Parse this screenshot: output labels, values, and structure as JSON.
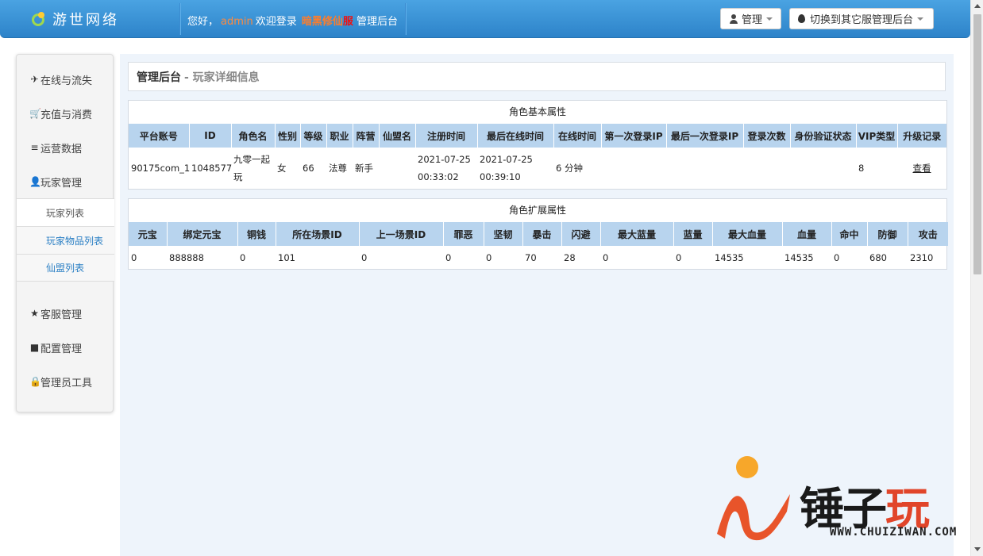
{
  "header": {
    "brand": "游世网络",
    "welcome_prefix": "您好，",
    "username": "admin",
    "welcome_mid": "欢迎登录",
    "server_name": "暗黑修仙",
    "server_suffix": "服",
    "welcome_suffix": "管理后台",
    "admin_button": "管理",
    "switch_button": "切换到其它服管理后台"
  },
  "sidebar": {
    "items": [
      {
        "icon": "airplane-icon",
        "glyph": "✈",
        "label": "在线与流失"
      },
      {
        "icon": "cart-icon",
        "glyph": "🛒",
        "label": "充值与消费"
      },
      {
        "icon": "list-icon",
        "glyph": "≡",
        "label": "运营数据"
      },
      {
        "icon": "user-icon",
        "glyph": "👤",
        "label": "玩家管理"
      }
    ],
    "sub_items": [
      {
        "label": "玩家列表"
      },
      {
        "label": "玩家物品列表"
      },
      {
        "label": "仙盟列表"
      }
    ],
    "items2": [
      {
        "icon": "star-icon",
        "glyph": "★",
        "label": "客服管理"
      },
      {
        "icon": "book-icon",
        "glyph": "■",
        "label": "配置管理"
      },
      {
        "icon": "lock-icon",
        "glyph": "🔒",
        "label": "管理员工具"
      }
    ]
  },
  "page": {
    "title": "管理后台",
    "subtitle": "- 玩家详细信息"
  },
  "basic": {
    "caption": "角色基本属性",
    "headers": [
      "平台账号",
      "ID",
      "角色名",
      "性别",
      "等级",
      "职业",
      "阵营",
      "仙盟名",
      "注册时间",
      "最后在线时间",
      "在线时间",
      "第一次登录IP",
      "最后一次登录IP",
      "登录次数",
      "身份验证状态",
      "VIP类型",
      "升级记录"
    ],
    "row": {
      "account": "90175com_1",
      "id": "1048577",
      "name": "九零一起玩",
      "gender": "女",
      "level": "66",
      "class": "法尊",
      "camp": "新手",
      "guild": "",
      "reg_time": "2021-07-25 00:33:02",
      "last_online": "2021-07-25 00:39:10",
      "online_time": "6 分钟",
      "first_ip": "",
      "last_ip": "",
      "login_count": "",
      "auth_status": "",
      "vip": "8",
      "upgrade": "查看"
    }
  },
  "extended": {
    "caption": "角色扩展属性",
    "headers": [
      "元宝",
      "绑定元宝",
      "铜钱",
      "所在场景ID",
      "上一场景ID",
      "罪恶",
      "坚韧",
      "暴击",
      "闪避",
      "最大蓝量",
      "蓝量",
      "最大血量",
      "血量",
      "命中",
      "防御",
      "攻击"
    ],
    "values": [
      "0",
      "888888",
      "0",
      "101",
      "0",
      "0",
      "0",
      "70",
      "28",
      "0",
      "0",
      "14535",
      "14535",
      "0",
      "680",
      "2310"
    ]
  },
  "watermark": {
    "text_black": "锤子",
    "text_red": "玩",
    "url": "WWW.CHUIZIWAN.COM"
  },
  "colors": {
    "header_blue": "#2d83c9",
    "table_header": "#b8d4ee",
    "link_blue": "#2a7fc4",
    "accent_orange": "#ff8a3d"
  }
}
